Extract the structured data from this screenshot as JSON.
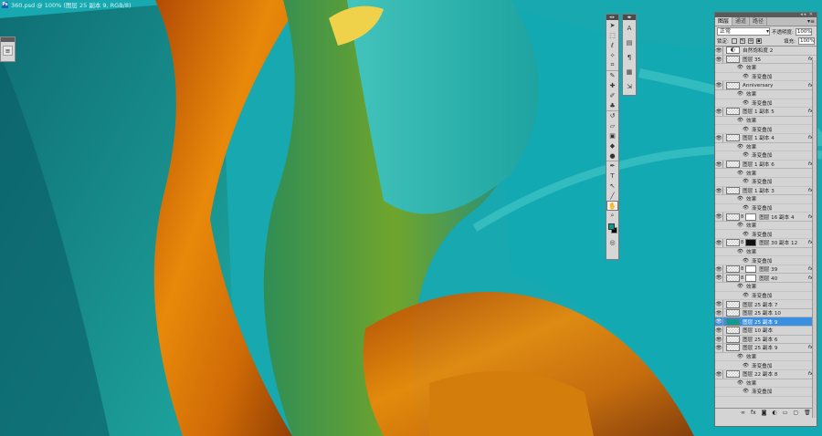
{
  "document": {
    "title": "360.psd @ 100% (图层 25 副本 9, RGB/8)",
    "app_badge": "Ps"
  },
  "colors": {
    "foreground": "#0c9a8e",
    "background": "#000000",
    "selection": "#3b8fe0",
    "canvas_base": "#17a8b0"
  },
  "mini_palette": {
    "icon": "adjust-sliders-icon"
  },
  "toolbox": {
    "tools": [
      {
        "name": "move-tool-icon",
        "glyph": "➤"
      },
      {
        "name": "marquee-tool-icon",
        "glyph": "⬚"
      },
      {
        "name": "lasso-tool-icon",
        "glyph": "ℓ"
      },
      {
        "name": "quick-select-tool-icon",
        "glyph": "✧"
      },
      {
        "name": "crop-tool-icon",
        "glyph": "⌗"
      },
      {
        "name": "eyedropper-tool-icon",
        "glyph": "✎"
      },
      {
        "name": "healing-brush-tool-icon",
        "glyph": "✚"
      },
      {
        "name": "brush-tool-icon",
        "glyph": "✐"
      },
      {
        "name": "clone-stamp-tool-icon",
        "glyph": "♣"
      },
      {
        "name": "history-brush-tool-icon",
        "glyph": "↺"
      },
      {
        "name": "eraser-tool-icon",
        "glyph": "▱"
      },
      {
        "name": "gradient-tool-icon",
        "glyph": "▣"
      },
      {
        "name": "blur-tool-icon",
        "glyph": "◆"
      },
      {
        "name": "dodge-tool-icon",
        "glyph": "●"
      },
      {
        "name": "pen-tool-icon",
        "glyph": "✒"
      },
      {
        "name": "type-tool-icon",
        "glyph": "T"
      },
      {
        "name": "path-select-tool-icon",
        "glyph": "↖"
      },
      {
        "name": "shape-tool-icon",
        "glyph": "╱"
      },
      {
        "name": "hand-tool-icon",
        "glyph": "✋"
      },
      {
        "name": "zoom-tool-icon",
        "glyph": "⌕"
      }
    ]
  },
  "side_dock": {
    "items": [
      {
        "name": "character-panel-icon",
        "glyph": "A"
      },
      {
        "name": "swatches-panel-icon",
        "glyph": "▤"
      },
      {
        "name": "paragraph-panel-icon",
        "glyph": "¶"
      },
      {
        "name": "styles-panel-icon",
        "glyph": "▦"
      },
      {
        "name": "navigator-panel-icon",
        "glyph": "⇲"
      }
    ]
  },
  "layers_panel": {
    "tabs": [
      "图层",
      "通道",
      "路径"
    ],
    "active_tab": 0,
    "blend_mode": "正常",
    "opacity_label": "不透明度:",
    "opacity_value": "100%",
    "lock_label": "锁定:",
    "fill_label": "填充:",
    "fill_value": "100%",
    "rows": [
      {
        "kind": "layer",
        "name": "自然饱和度 2",
        "thumb": "adjust",
        "fx": ""
      },
      {
        "kind": "layer",
        "name": "图层 35",
        "thumb": "checker",
        "fx": "fx"
      },
      {
        "kind": "effects",
        "label": "效果"
      },
      {
        "kind": "effect",
        "label": "渐变叠加"
      },
      {
        "kind": "layer",
        "name": "Anniversary",
        "thumb": "checker",
        "fx": "fx"
      },
      {
        "kind": "effects",
        "label": "效果"
      },
      {
        "kind": "effect",
        "label": "渐变叠加"
      },
      {
        "kind": "layer",
        "name": "图层 1 副本 5",
        "thumb": "checker",
        "fx": "fx"
      },
      {
        "kind": "effects",
        "label": "效果"
      },
      {
        "kind": "effect",
        "label": "渐变叠加"
      },
      {
        "kind": "layer",
        "name": "图层 1 副本 4",
        "thumb": "checker",
        "fx": "fx"
      },
      {
        "kind": "effects",
        "label": "效果"
      },
      {
        "kind": "effect",
        "label": "渐变叠加"
      },
      {
        "kind": "layer",
        "name": "图层 1 副本 6",
        "thumb": "checker",
        "fx": "fx"
      },
      {
        "kind": "effects",
        "label": "效果"
      },
      {
        "kind": "effect",
        "label": "渐变叠加"
      },
      {
        "kind": "layer",
        "name": "图层 1 副本 3",
        "thumb": "checker",
        "fx": "fx"
      },
      {
        "kind": "effects",
        "label": "效果"
      },
      {
        "kind": "effect",
        "label": "渐变叠加"
      },
      {
        "kind": "layer",
        "name": "图层 16 副本 4",
        "thumb": "checker",
        "mask": "white",
        "fx": "fx"
      },
      {
        "kind": "effects",
        "label": "效果"
      },
      {
        "kind": "effect",
        "label": "渐变叠加"
      },
      {
        "kind": "layer",
        "name": "图层 30 副本 12",
        "thumb": "checker",
        "mask": "black",
        "fx": "fx"
      },
      {
        "kind": "effects",
        "label": "效果"
      },
      {
        "kind": "effect",
        "label": "渐变叠加"
      },
      {
        "kind": "layer",
        "name": "图层 39",
        "thumb": "checker",
        "mask": "white",
        "fx": "fx"
      },
      {
        "kind": "layer",
        "name": "图层 40",
        "thumb": "checker",
        "mask": "white",
        "fx": "fx"
      },
      {
        "kind": "effects",
        "label": "效果"
      },
      {
        "kind": "effect",
        "label": "渐变叠加"
      },
      {
        "kind": "layer",
        "name": "图层 25 副本 7",
        "thumb": "checker",
        "fx": ""
      },
      {
        "kind": "layer",
        "name": "图层 25 副本 10",
        "thumb": "checker",
        "fx": ""
      },
      {
        "kind": "layer",
        "name": "图层 25 副本 9",
        "thumb": "teal",
        "fx": "",
        "selected": true
      },
      {
        "kind": "layer",
        "name": "图层 10 副本",
        "thumb": "checker",
        "fx": ""
      },
      {
        "kind": "layer",
        "name": "图层 25 副本 6",
        "thumb": "checker",
        "fx": ""
      },
      {
        "kind": "layer",
        "name": "图层 25 副本 9",
        "thumb": "checker",
        "fx": "fx"
      },
      {
        "kind": "effects",
        "label": "效果"
      },
      {
        "kind": "effect",
        "label": "渐变叠加"
      },
      {
        "kind": "layer",
        "name": "图层 22 副本 8",
        "thumb": "checker",
        "fx": "fx"
      },
      {
        "kind": "effects",
        "label": "效果"
      },
      {
        "kind": "effect",
        "label": "渐变叠加"
      }
    ],
    "bottom_icons": [
      {
        "name": "link-layers-icon",
        "glyph": "∞"
      },
      {
        "name": "add-style-icon",
        "glyph": "fx"
      },
      {
        "name": "add-mask-icon",
        "glyph": "◙"
      },
      {
        "name": "new-adjustment-icon",
        "glyph": "◐"
      },
      {
        "name": "new-group-icon",
        "glyph": "▭"
      },
      {
        "name": "new-layer-icon",
        "glyph": "▢"
      },
      {
        "name": "delete-layer-icon",
        "glyph": "🗑"
      }
    ]
  }
}
